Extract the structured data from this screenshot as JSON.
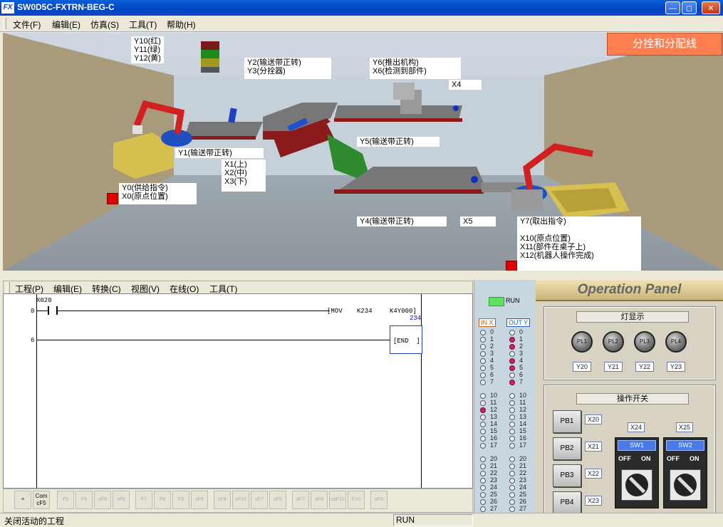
{
  "window": {
    "title": "SW0D5C-FXTRN-BEG-C",
    "logo": "FX"
  },
  "main_menu": [
    "文件(F)",
    "编辑(E)",
    "仿真(S)",
    "工具(T)",
    "帮助(H)"
  ],
  "scene": {
    "title": "分拴和分配线",
    "labels": {
      "lamps": "Y10(红)\nY11(绿)\nY12(黄)",
      "y2y3": "Y2(输送带正转)\nY3(分拴器)",
      "y6x6": "Y6(推出机构)\nX6(检测到部件)",
      "x4": "X4",
      "y1": "Y1(输送带正转)",
      "y5": "Y5(输送带正转)",
      "x123": "X1(上)\nX2(中)\nX3(下)",
      "y0x0": "Y0(供给指令)\nX0(原点位置)",
      "y4": "Y4(输送带正转)",
      "x5": "X5",
      "y7": "Y7(取出指令)\n\nX10(原点位置)\nX11(部件在桌子上)\nX12(机器人操作完成)"
    }
  },
  "ladder_menu": [
    "工程(P)",
    "编辑(E)",
    "转换(C)",
    "视图(V)",
    "在线(O)",
    "工具(T)"
  ],
  "ladder": {
    "contact": "X020",
    "step0": "0",
    "step6": "6",
    "instr": "MOV",
    "operand1": "K234",
    "operand2": "K4Y000",
    "monitor": "234",
    "end": "END"
  },
  "io_panel": {
    "run": "RUN",
    "in_header": "IN X",
    "out_header": "OUT Y",
    "group1": [
      "0",
      "1",
      "2",
      "3",
      "4",
      "5",
      "6",
      "7"
    ],
    "group2": [
      "10",
      "11",
      "12",
      "13",
      "14",
      "15",
      "16",
      "17"
    ],
    "group3": [
      "20",
      "21",
      "22",
      "23",
      "24",
      "25",
      "26",
      "27"
    ],
    "in_on": [
      "12"
    ],
    "out_on": [
      "1",
      "2",
      "4",
      "5",
      "7"
    ]
  },
  "operation_panel": {
    "title": "Operation Panel",
    "lamp_section": "灯显示",
    "lamps": [
      {
        "name": "PL1",
        "tag": "Y20"
      },
      {
        "name": "PL2",
        "tag": "Y21"
      },
      {
        "name": "PL3",
        "tag": "Y22"
      },
      {
        "name": "PL4",
        "tag": "Y23"
      }
    ],
    "switch_section": "操作开关",
    "buttons": [
      {
        "name": "PB1",
        "tag": "X20"
      },
      {
        "name": "PB2",
        "tag": "X21"
      },
      {
        "name": "PB3",
        "tag": "X22"
      },
      {
        "name": "PB4",
        "tag": "X23"
      }
    ],
    "switches": [
      {
        "name": "SW1",
        "tag": "X24",
        "off": "OFF",
        "on": "ON"
      },
      {
        "name": "SW2",
        "tag": "X25",
        "off": "OFF",
        "on": "ON"
      }
    ]
  },
  "toolbar": {
    "com_label": "Com\ncF5",
    "keys": [
      "F5",
      "F6",
      "sF5",
      "sF6",
      "F7",
      "F8",
      "F9",
      "sF9",
      "cF9",
      "cF10",
      "sF7",
      "sF8",
      "aF7",
      "aF8",
      "caF10",
      "F10",
      "aF9"
    ]
  },
  "status": {
    "left": "关闭活动的工程",
    "mode": "RUN"
  },
  "colors": {
    "accent": "#ff7f50",
    "led_on": "#d0205a",
    "run": "#60e060"
  }
}
